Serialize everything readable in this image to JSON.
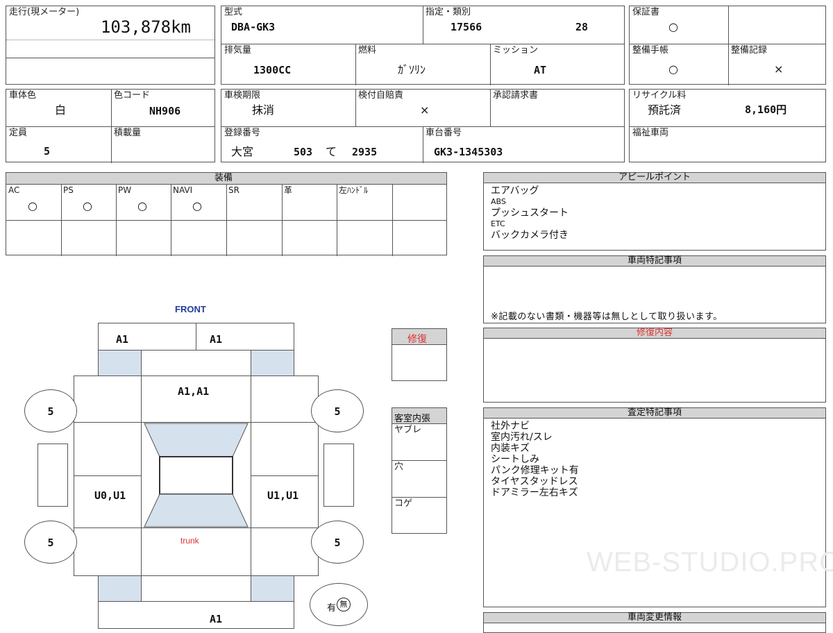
{
  "mileage": {
    "label": "走行(現メーター)",
    "value": "103,878km"
  },
  "model": {
    "label": "型式",
    "value": "DBA-GK3"
  },
  "designation": {
    "label": "指定・類別",
    "value1": "17566",
    "value2": "28"
  },
  "warranty": {
    "label": "保証書",
    "value": "○"
  },
  "displacement": {
    "label": "排気量",
    "value": "1300CC"
  },
  "fuel": {
    "label": "燃料",
    "value": "ｶﾞｿﾘﾝ"
  },
  "mission": {
    "label": "ミッション",
    "value": "AT"
  },
  "maintenance_book": {
    "label": "整備手帳",
    "value": "○"
  },
  "maintenance_record": {
    "label": "整備記録",
    "value": "×"
  },
  "body_color": {
    "label": "車体色",
    "value": "白"
  },
  "color_code": {
    "label": "色コード",
    "value": "NH906"
  },
  "inspection_expiry": {
    "label": "車検期限",
    "value": "抹消"
  },
  "insurance": {
    "label": "検付自賠責",
    "value": "×"
  },
  "approval": {
    "label": "承認請求書",
    "value": ""
  },
  "recycle": {
    "label": "リサイクル料",
    "status": "預託済",
    "amount": "8,160円"
  },
  "capacity": {
    "label": "定員",
    "value": "5"
  },
  "load": {
    "label": "積載量",
    "value": ""
  },
  "registration": {
    "label": "登録番号",
    "region": "大宮",
    "number": "503",
    "kana": "て",
    "serial": "2935"
  },
  "chassis": {
    "label": "車台番号",
    "value": "GK3-1345303"
  },
  "welfare": {
    "label": "福祉車両",
    "value": ""
  },
  "equipment": {
    "title": "装備",
    "items": [
      {
        "label": "AC",
        "value": "○"
      },
      {
        "label": "PS",
        "value": "○"
      },
      {
        "label": "PW",
        "value": "○"
      },
      {
        "label": "NAVI",
        "value": "○"
      },
      {
        "label": "SR",
        "value": ""
      },
      {
        "label": "革",
        "value": ""
      },
      {
        "label": "左ﾊﾝﾄﾞﾙ",
        "value": ""
      }
    ]
  },
  "appeal": {
    "title": "アピールポイント",
    "lines": [
      {
        "text": "エアバッグ",
        "small": false
      },
      {
        "text": "ABS",
        "small": true
      },
      {
        "text": "プッシュスタート",
        "small": false
      },
      {
        "text": "ETC",
        "small": true
      },
      {
        "text": "バックカメラ付き",
        "small": false
      }
    ]
  },
  "vehicle_notes": {
    "title": "車両特記事項",
    "note": "※記載のない書類・機器等は無しとして取り扱います。"
  },
  "repair_content": {
    "title": "修復内容"
  },
  "assessment": {
    "title": "査定特記事項",
    "lines": [
      "社外ナビ",
      "室内汚れ/スレ",
      "内装キズ",
      "シートしみ",
      "パンク修理キット有",
      "タイヤスタッドレス",
      "ドアミラー左右キズ"
    ]
  },
  "vehicle_change": {
    "title": "車両変更情報"
  },
  "repair": {
    "label": "修復"
  },
  "interior": {
    "label": "客室内張",
    "rows": [
      "ヤブレ",
      "穴",
      "コゲ"
    ]
  },
  "diagram": {
    "front_label": "FRONT",
    "trunk_label": "trunk",
    "bumper_left": "A1",
    "bumper_right": "A1",
    "hood": "A1,A1",
    "left_side": "U0,U1",
    "right_side": "U1,U1",
    "rear": "A1",
    "tires": [
      "5",
      "5",
      "5",
      "5"
    ],
    "spare": {
      "yes": "有",
      "no": "無"
    }
  },
  "watermark": "WEB-STUDIO.PRO"
}
